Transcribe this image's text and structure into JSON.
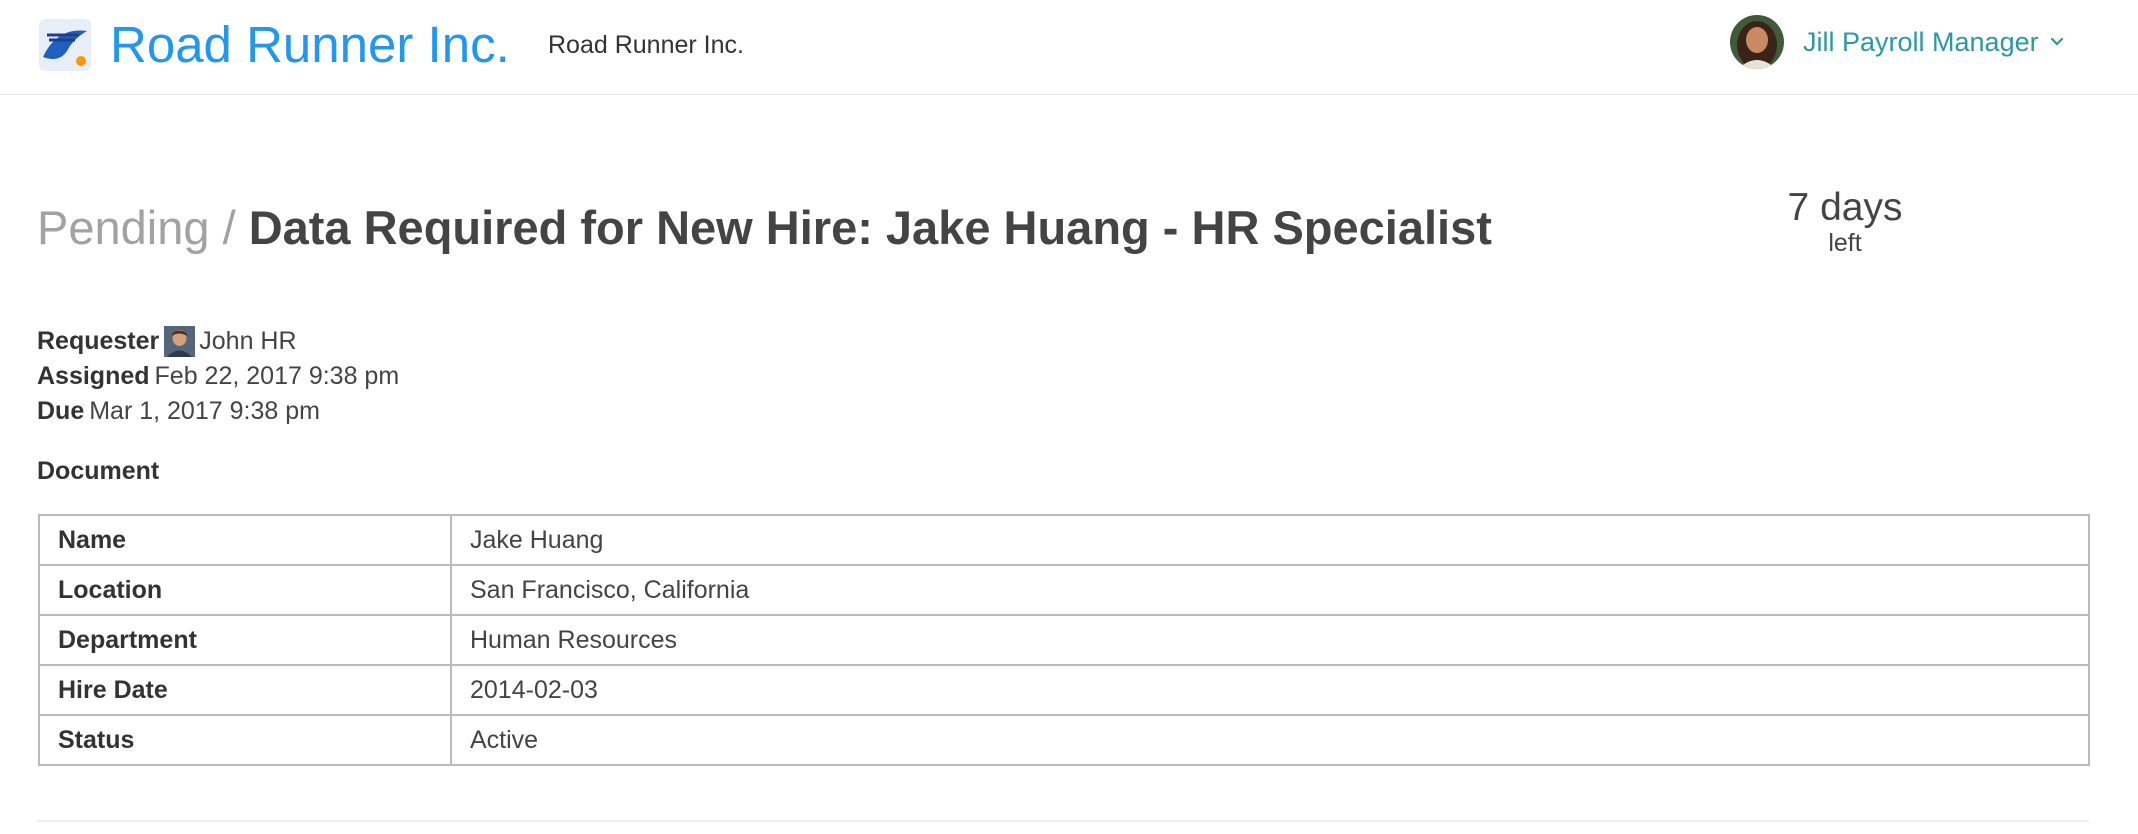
{
  "header": {
    "brand": "Road Runner Inc.",
    "company": "Road Runner Inc.",
    "user_name": "Jill Payroll Manager",
    "icons": [
      "roadrunner-logo-icon",
      "avatar-jill",
      "chevron-down-icon"
    ],
    "brand_color": "#2196f3",
    "user_color": "#2a9aa0"
  },
  "task": {
    "crumb": "Pending",
    "crumb_separator": "/",
    "title": "Data Required for New Hire: Jake Huang - HR Specialist",
    "countdown_value": "7 days",
    "countdown_unit": "left"
  },
  "meta": {
    "requester_label": "Requester",
    "requester_value": "John HR",
    "assigned_label": "Assigned",
    "assigned_value": "Feb 22, 2017 9:38 pm",
    "due_label": "Due",
    "due_value": "Mar 1, 2017 9:38 pm"
  },
  "document": {
    "heading": "Document",
    "rows": [
      {
        "label": "Name",
        "value": "Jake Huang"
      },
      {
        "label": "Location",
        "value": "San Francisco, California"
      },
      {
        "label": "Department",
        "value": "Human Resources"
      },
      {
        "label": "Hire Date",
        "value": "2014-02-03"
      },
      {
        "label": "Status",
        "value": "Active"
      }
    ]
  }
}
